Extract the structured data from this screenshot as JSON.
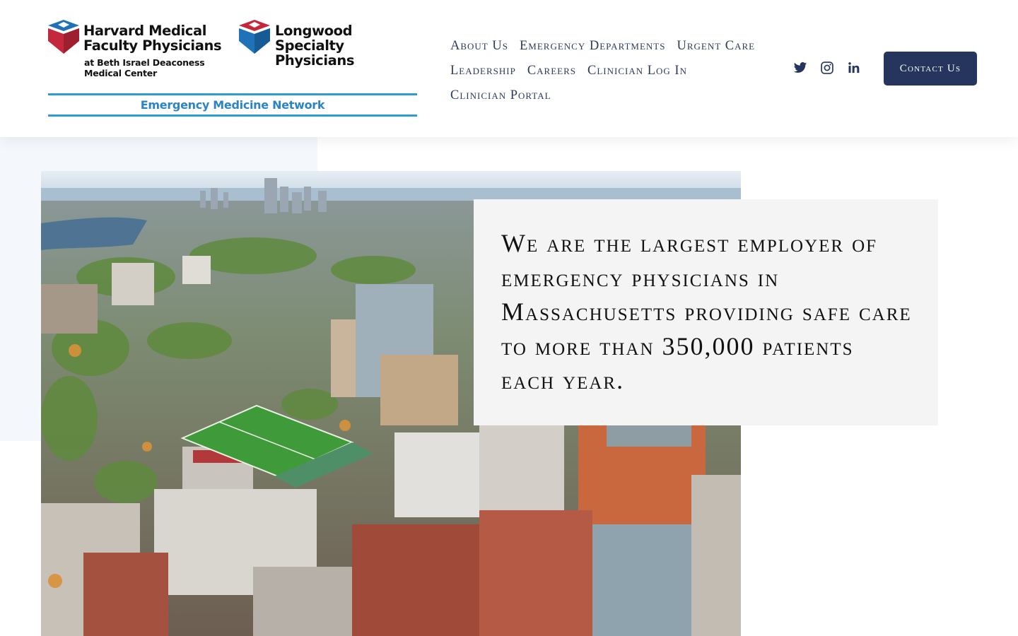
{
  "logo": {
    "left_name_line1": "Harvard Medical",
    "left_name_line2": "Faculty Physicians",
    "left_sub_line1": "at Beth Israel Deaconess",
    "left_sub_line2": "Medical Center",
    "right_name_line1": "Longwood",
    "right_name_line2": "Specialty Physicians",
    "network": "Emergency Medicine Network",
    "colors": {
      "red": "#c4283c",
      "blue": "#1f72b8",
      "line": "#2d9bd6"
    }
  },
  "nav": {
    "row1": [
      "About Us",
      "Emergency Departments",
      "Urgent Care"
    ],
    "row2": [
      "Leadership",
      "Careers",
      "Clinician Log In"
    ],
    "row3": [
      "Clinician Portal"
    ]
  },
  "social": {
    "icons": [
      "twitter-icon",
      "instagram-icon",
      "linkedin-icon"
    ]
  },
  "cta": {
    "label": "Contact Us"
  },
  "hero": {
    "statement": "We are the largest employer of emergency physicians in Massachusetts providing safe care to more than 350,000 patients each year.",
    "image_subject": "aerial view of city medical district"
  },
  "colors": {
    "navy": "#26355e",
    "text": "#2c3a5e",
    "quote_bg": "#f4f4f4",
    "tint": "#f4f7fb"
  }
}
